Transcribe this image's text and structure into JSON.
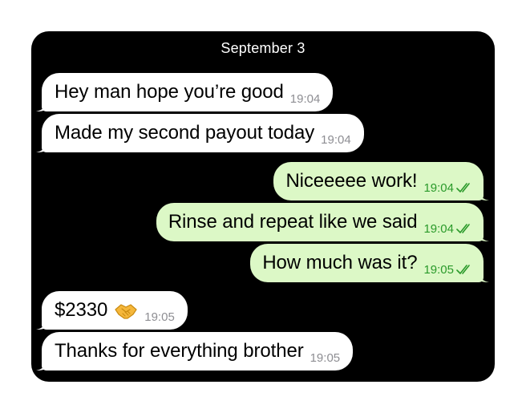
{
  "date_header": "September 3",
  "messages": [
    {
      "text": "Hey man hope you’re good",
      "time": "19:04",
      "direction": "incoming"
    },
    {
      "text": "Made my second payout today",
      "time": "19:04",
      "direction": "incoming"
    },
    {
      "text": "Niceeeee work!",
      "time": "19:04",
      "direction": "outgoing",
      "status": "read"
    },
    {
      "text": "Rinse and repeat like we said",
      "time": "19:04",
      "direction": "outgoing",
      "status": "read"
    },
    {
      "text": "How much was it?",
      "time": "19:05",
      "direction": "outgoing",
      "status": "read"
    },
    {
      "text": "$2330",
      "emoji": "handshake-emoji",
      "time": "19:05",
      "direction": "incoming"
    },
    {
      "text": "Thanks for everything brother",
      "time": "19:05",
      "direction": "incoming"
    }
  ],
  "colors": {
    "chat_background": "#000000",
    "incoming_bubble": "#ffffff",
    "outgoing_bubble": "#dcf8c6",
    "outgoing_timestamp": "#2a9a2a",
    "incoming_timestamp": "#8e8e93"
  }
}
